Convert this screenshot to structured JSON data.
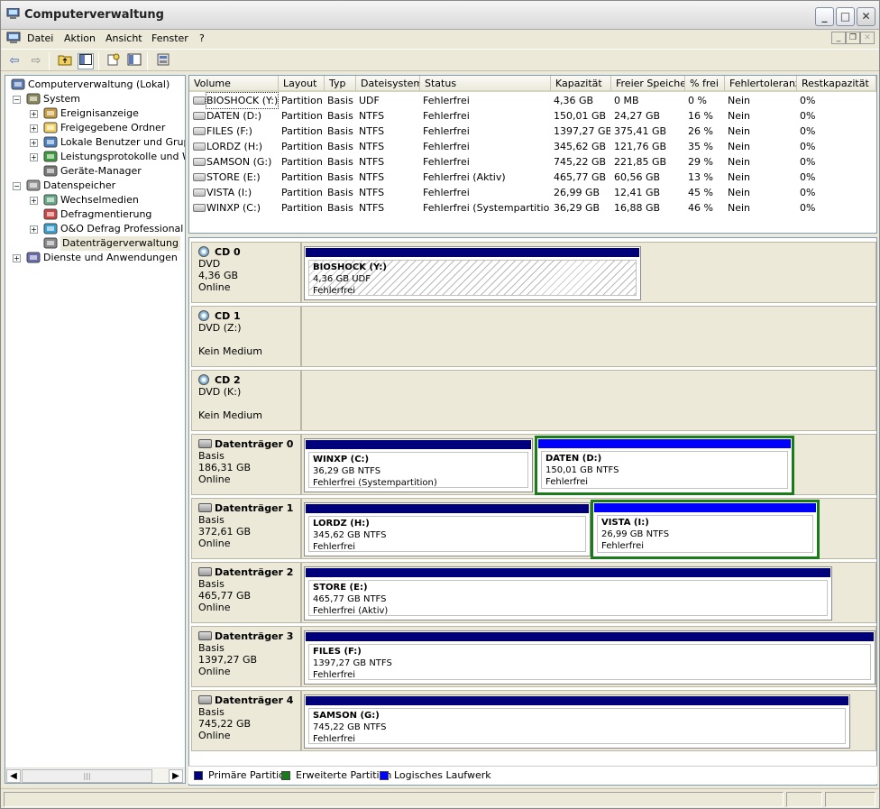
{
  "window": {
    "title": "Computerverwaltung"
  },
  "menu": {
    "items": [
      "Datei",
      "Aktion",
      "Ansicht",
      "Fenster",
      "?"
    ]
  },
  "tree": {
    "items": [
      {
        "label": "Computerverwaltung (Lokal)",
        "icon": "computer-icon",
        "level": 0,
        "expander": ""
      },
      {
        "label": "System",
        "icon": "system-tools-icon",
        "level": 1,
        "expander": "−"
      },
      {
        "label": "Ereignisanzeige",
        "icon": "event-viewer-icon",
        "level": 2,
        "expander": "+"
      },
      {
        "label": "Freigegebene Ordner",
        "icon": "shared-folder-icon",
        "level": 2,
        "expander": "+"
      },
      {
        "label": "Lokale Benutzer und Gruppen",
        "icon": "users-icon",
        "level": 2,
        "expander": "+"
      },
      {
        "label": "Leistungsprotokolle und Warnungen",
        "icon": "performance-icon",
        "level": 2,
        "expander": "+"
      },
      {
        "label": "Geräte-Manager",
        "icon": "device-manager-icon",
        "level": 2,
        "expander": ""
      },
      {
        "label": "Datenspeicher",
        "icon": "storage-icon",
        "level": 1,
        "expander": "−"
      },
      {
        "label": "Wechselmedien",
        "icon": "removable-media-icon",
        "level": 2,
        "expander": "+"
      },
      {
        "label": "Defragmentierung",
        "icon": "defrag-icon",
        "level": 2,
        "expander": ""
      },
      {
        "label": "O&O Defrag Professional Edition",
        "icon": "oo-defrag-icon",
        "level": 2,
        "expander": "+"
      },
      {
        "label": "Datenträgerverwaltung",
        "icon": "disk-management-icon",
        "level": 2,
        "expander": "",
        "selected": true
      },
      {
        "label": "Dienste und Anwendungen",
        "icon": "services-icon",
        "level": 1,
        "expander": "+"
      }
    ]
  },
  "volume_table": {
    "columns": [
      "Volume",
      "Layout",
      "Typ",
      "Dateisystem",
      "Status",
      "Kapazität",
      "Freier Speicher",
      "% frei",
      "Fehlertoleranz",
      "Restkapazität"
    ],
    "rows": [
      [
        "BIOSHOCK (Y:)",
        "Partition",
        "Basis",
        "UDF",
        "Fehlerfrei",
        "4,36 GB",
        "0 MB",
        "0 %",
        "Nein",
        "0%"
      ],
      [
        "DATEN (D:)",
        "Partition",
        "Basis",
        "NTFS",
        "Fehlerfrei",
        "150,01 GB",
        "24,27 GB",
        "16 %",
        "Nein",
        "0%"
      ],
      [
        "FILES (F:)",
        "Partition",
        "Basis",
        "NTFS",
        "Fehlerfrei",
        "1397,27 GB",
        "375,41 GB",
        "26 %",
        "Nein",
        "0%"
      ],
      [
        "LORDZ (H:)",
        "Partition",
        "Basis",
        "NTFS",
        "Fehlerfrei",
        "345,62 GB",
        "121,76 GB",
        "35 %",
        "Nein",
        "0%"
      ],
      [
        "SAMSON (G:)",
        "Partition",
        "Basis",
        "NTFS",
        "Fehlerfrei",
        "745,22 GB",
        "221,85 GB",
        "29 %",
        "Nein",
        "0%"
      ],
      [
        "STORE (E:)",
        "Partition",
        "Basis",
        "NTFS",
        "Fehlerfrei (Aktiv)",
        "465,77 GB",
        "60,56 GB",
        "13 %",
        "Nein",
        "0%"
      ],
      [
        "VISTA (I:)",
        "Partition",
        "Basis",
        "NTFS",
        "Fehlerfrei",
        "26,99 GB",
        "12,41 GB",
        "45 %",
        "Nein",
        "0%"
      ],
      [
        "WINXP (C:)",
        "Partition",
        "Basis",
        "NTFS",
        "Fehlerfrei (Systempartition)",
        "36,29 GB",
        "16,88 GB",
        "46 %",
        "Nein",
        "0%"
      ]
    ]
  },
  "disks": [
    {
      "name": "CD 0",
      "line1": "DVD",
      "line2": "4,36 GB",
      "line3": "Online",
      "cd": true,
      "partitions": [
        {
          "name": "BIOSHOCK  (Y:)",
          "size": "4,36 GB UDF",
          "status": "Fehlerfrei",
          "kind": "primary"
        }
      ]
    },
    {
      "name": "CD 1",
      "line1": "DVD (Z:)",
      "line2": "",
      "line3": "Kein Medium",
      "cd": true,
      "partitions": []
    },
    {
      "name": "CD 2",
      "line1": "DVD (K:)",
      "line2": "",
      "line3": "Kein Medium",
      "cd": true,
      "partitions": []
    },
    {
      "name": "Datenträger 0",
      "line1": "Basis",
      "line2": "186,31 GB",
      "line3": "Online",
      "partitions": [
        {
          "name": "WINXP  (C:)",
          "size": "36,29 GB NTFS",
          "status": "Fehlerfrei (Systempartition)",
          "kind": "primary"
        },
        {
          "name": "DATEN  (D:)",
          "size": "150,01 GB NTFS",
          "status": "Fehlerfrei",
          "kind": "logical"
        }
      ]
    },
    {
      "name": "Datenträger 1",
      "line1": "Basis",
      "line2": "372,61 GB",
      "line3": "Online",
      "partitions": [
        {
          "name": "LORDZ  (H:)",
          "size": "345,62 GB NTFS",
          "status": "Fehlerfrei",
          "kind": "primary"
        },
        {
          "name": "VISTA  (I:)",
          "size": "26,99 GB NTFS",
          "status": "Fehlerfrei",
          "kind": "logical"
        }
      ]
    },
    {
      "name": "Datenträger 2",
      "line1": "Basis",
      "line2": "465,77 GB",
      "line3": "Online",
      "partitions": [
        {
          "name": "STORE  (E:)",
          "size": "465,77 GB NTFS",
          "status": "Fehlerfrei (Aktiv)",
          "kind": "primary"
        }
      ]
    },
    {
      "name": "Datenträger 3",
      "line1": "Basis",
      "line2": "1397,27 GB",
      "line3": "Online",
      "partitions": [
        {
          "name": "FILES  (F:)",
          "size": "1397,27 GB NTFS",
          "status": "Fehlerfrei",
          "kind": "primary"
        }
      ]
    },
    {
      "name": "Datenträger 4",
      "line1": "Basis",
      "line2": "745,22 GB",
      "line3": "Online",
      "partitions": [
        {
          "name": "SAMSON  (G:)",
          "size": "745,22 GB NTFS",
          "status": "Fehlerfrei",
          "kind": "primary"
        }
      ]
    }
  ],
  "legend": {
    "items": [
      {
        "label": "Primäre Partition",
        "color": "#00007b"
      },
      {
        "label": "Erweiterte Partition",
        "color": "#1a7b1a"
      },
      {
        "label": "Logisches Laufwerk",
        "color": "#0000ff"
      }
    ]
  },
  "colors": {
    "primary": "#00007b",
    "extended": "#1a7b1a",
    "logical": "#0000ff"
  }
}
